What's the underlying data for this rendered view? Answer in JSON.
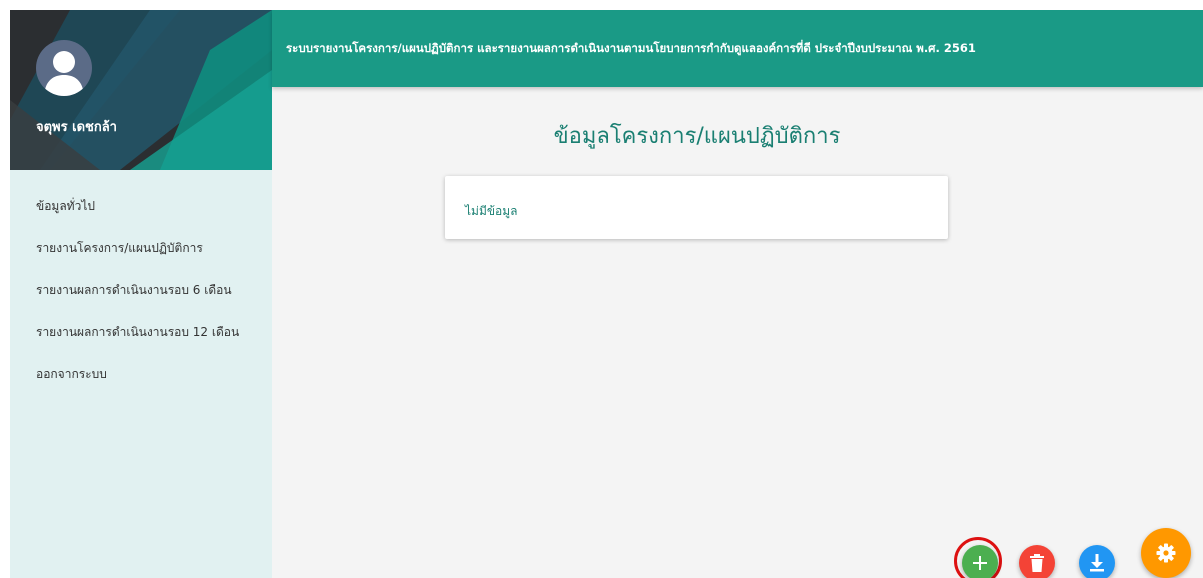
{
  "user": {
    "name": "จตุพร เดชกล้า"
  },
  "sidebar": {
    "items": [
      {
        "label": "ข้อมูลทั่วไป"
      },
      {
        "label": "รายงานโครงการ/แผนปฏิบัติการ"
      },
      {
        "label": "รายงานผลการดำเนินงานรอบ 6 เดือน"
      },
      {
        "label": "รายงานผลการดำเนินงานรอบ 12 เดือน"
      },
      {
        "label": "ออกจากระบบ"
      }
    ]
  },
  "header": {
    "title": "ระบบรายงานโครงการ/แผนปฏิบัติการ และรายงานผลการดำเนินงานตามนโยบายการกำกับดูแลองค์การที่ดี ประจำปีงบประมาณ พ.ศ. 2561"
  },
  "main": {
    "title": "ข้อมูลโครงการ/แผนปฏิบัติการ",
    "empty_text": "ไม่มีข้อมูล"
  },
  "actions": {
    "add_icon": "plus-icon",
    "delete_icon": "trash-icon",
    "download_icon": "download-icon",
    "settings_icon": "gear-icon"
  },
  "colors": {
    "header": "#1a9a86",
    "sidebar": "#e1f1f1",
    "title_text": "#1a7f72",
    "add": "#4caf50",
    "delete": "#f44336",
    "download": "#2196f3",
    "settings": "#ff9800",
    "highlight_ring": "#dd1111"
  }
}
